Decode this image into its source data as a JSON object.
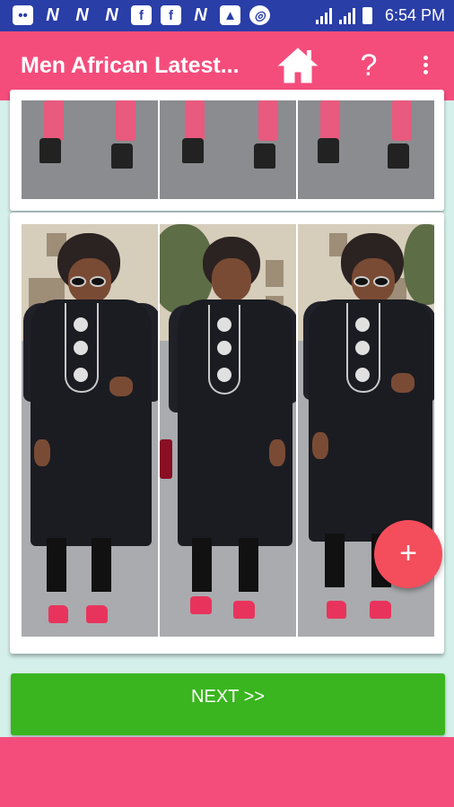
{
  "status_bar": {
    "time": "6:54 PM",
    "notification_icons": [
      "message-icon",
      "n-icon",
      "n-icon",
      "n-icon",
      "facebook-icon",
      "facebook-icon",
      "n-icon",
      "image-icon",
      "ring-icon"
    ]
  },
  "app_bar": {
    "title": "Men African Latest...",
    "help_label": "?"
  },
  "fab": {
    "label": "+"
  },
  "next_button": {
    "label": "NEXT >>"
  },
  "colors": {
    "status_bar": "#2a3ea8",
    "app_bar": "#f44d7c",
    "fab": "#f44d5c",
    "next_button": "#3ab51f",
    "background": "#d5f0ea"
  }
}
